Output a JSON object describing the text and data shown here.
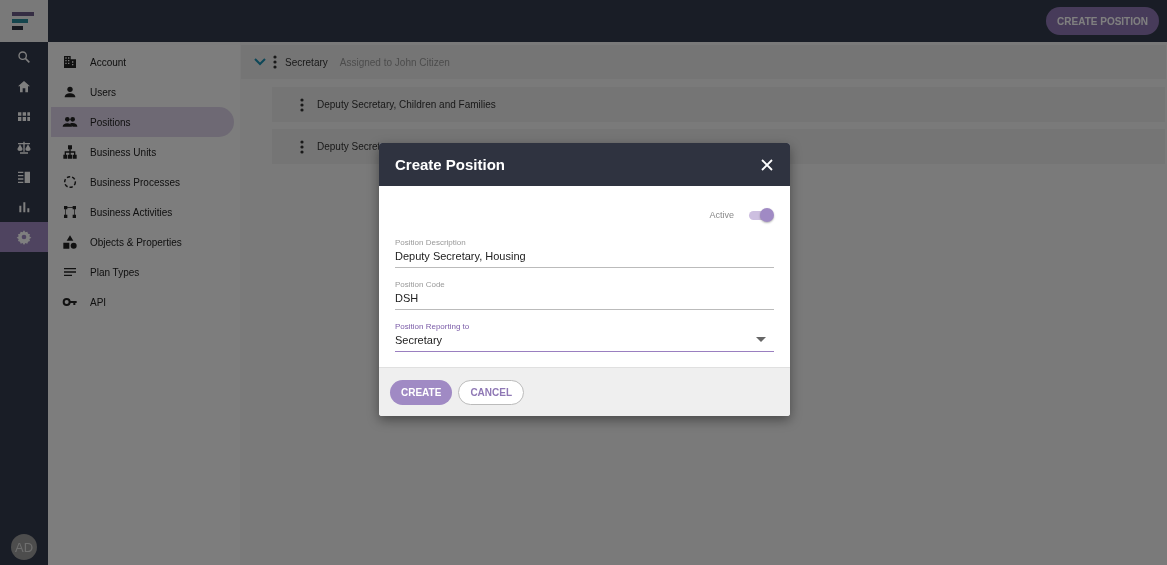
{
  "rail": {
    "items": [
      {
        "selected": false
      },
      {
        "selected": false
      },
      {
        "selected": false
      },
      {
        "selected": false
      },
      {
        "selected": false
      },
      {
        "selected": false
      },
      {
        "selected": true
      }
    ],
    "avatar": "AD"
  },
  "topbar": {
    "action": "CREATE POSITION"
  },
  "settings_menu": [
    {
      "label": "Account",
      "selected": false
    },
    {
      "label": "Users",
      "selected": false
    },
    {
      "label": "Positions",
      "selected": true
    },
    {
      "label": "Business Units",
      "selected": false
    },
    {
      "label": "Business Processes",
      "selected": false
    },
    {
      "label": "Business Activities",
      "selected": false
    },
    {
      "label": "Objects & Properties",
      "selected": false
    },
    {
      "label": "Plan Types",
      "selected": false
    },
    {
      "label": "API",
      "selected": false
    }
  ],
  "tree": [
    {
      "name": "Secretary",
      "assignee": "Assigned to John Citizen",
      "expanded": true,
      "children": [
        {
          "name": "Deputy Secretary, Children and Families"
        },
        {
          "name": "Deputy Secret"
        }
      ]
    }
  ],
  "dialog": {
    "title": "Create Position",
    "active": {
      "label": "Active",
      "on": true
    },
    "fields": [
      {
        "kind": "text",
        "label": "Position Description",
        "value": "Deputy Secretary, Housing",
        "focused": false
      },
      {
        "kind": "text",
        "label": "Position Code",
        "value": "DSH",
        "focused": false
      },
      {
        "kind": "select",
        "label": "Position Reporting to",
        "value": "Secretary",
        "focused": true
      }
    ],
    "buttons": [
      {
        "label": "CREATE",
        "kind": "primary"
      },
      {
        "label": "CANCEL",
        "kind": "secondary"
      }
    ]
  }
}
